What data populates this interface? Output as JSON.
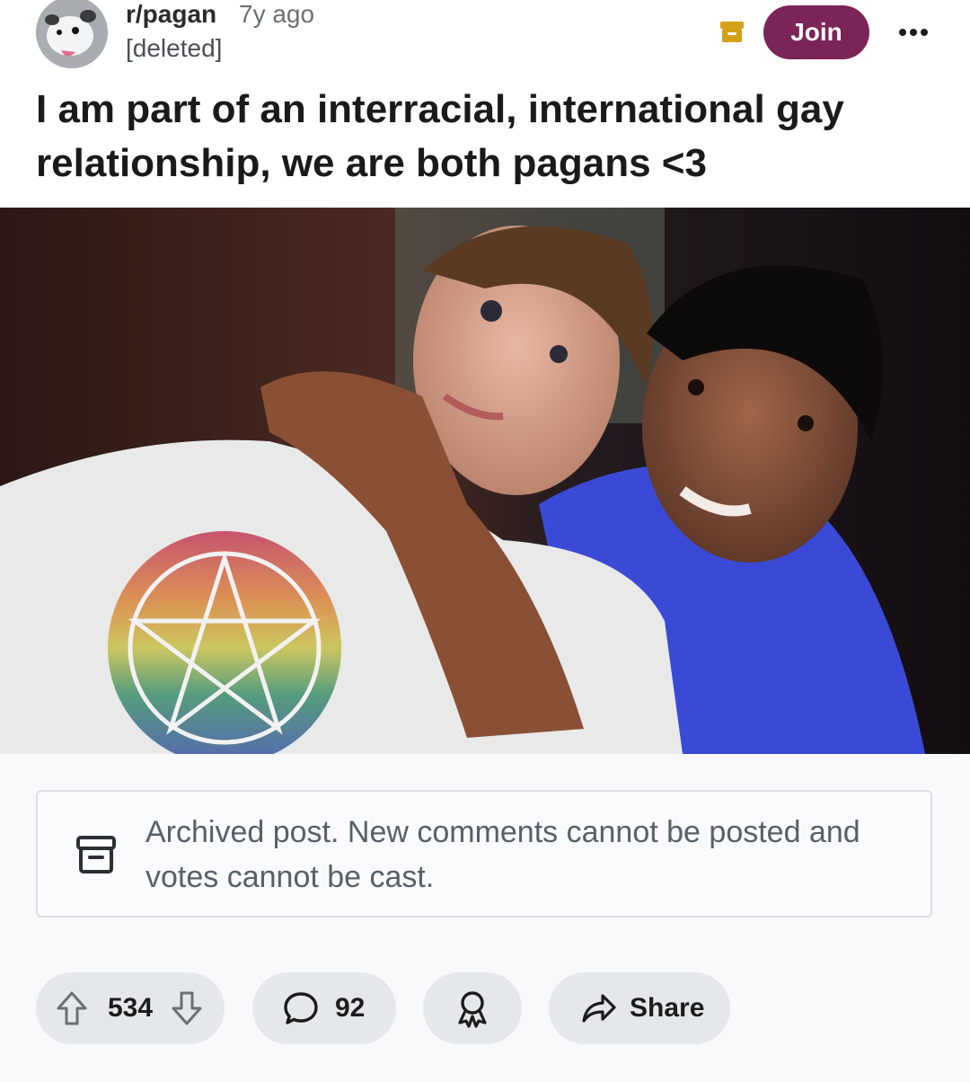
{
  "post": {
    "subreddit": "r/pagan",
    "time_ago": "7y ago",
    "author": "[deleted]",
    "title": "I am part of an interracial, international gay relationship, we are both pagans <3",
    "join_label": "Join"
  },
  "archive_notice": {
    "text": "Archived post. New comments cannot be posted and votes cannot be cast."
  },
  "actions": {
    "upvotes": "534",
    "comments": "92",
    "share_label": "Share"
  },
  "colors": {
    "join_button": "#7b2556",
    "archive_badge": "#d4a017",
    "pill_background": "#e5e8eb"
  },
  "icons": [
    "opossum-avatar-icon",
    "archive-icon",
    "more-icon",
    "upvote-icon",
    "downvote-icon",
    "comment-icon",
    "award-icon",
    "share-icon"
  ]
}
